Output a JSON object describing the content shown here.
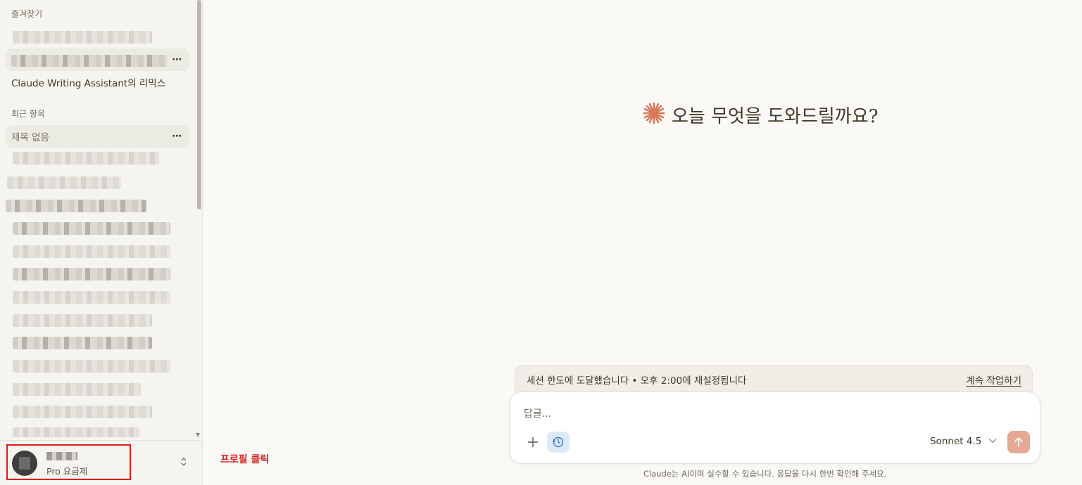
{
  "sidebar": {
    "favorites_label": "즐겨찾기",
    "favorite_named_item": "Claude Writing Assistant의 리믹스",
    "recents_label": "최근 항목",
    "active_recent_item": "제목 없음",
    "more_icon": "⋯"
  },
  "profile": {
    "plan": "Pro 요금제",
    "toggle_icon": "chevron-up-down-icon"
  },
  "annotation": {
    "text": "프로필 클릭",
    "color": "#e01b1b"
  },
  "main": {
    "greeting": "오늘 무엇을 도와드릴까요?",
    "limit_notice": "세션 한도에 도달했습니다 • 오후 2:00에 재설정됩니다",
    "continue_link": "계속 작업하기",
    "composer": {
      "placeholder": "답글...",
      "model": "Sonnet 4.5"
    },
    "disclaimer": "Claude는 AI이며 실수할 수 있습니다. 응답을 다시 한번 확인해 주세요."
  },
  "colors": {
    "accent": "#d97757",
    "send_button": "#e5a893",
    "history_button_bg": "#dde9f6"
  }
}
